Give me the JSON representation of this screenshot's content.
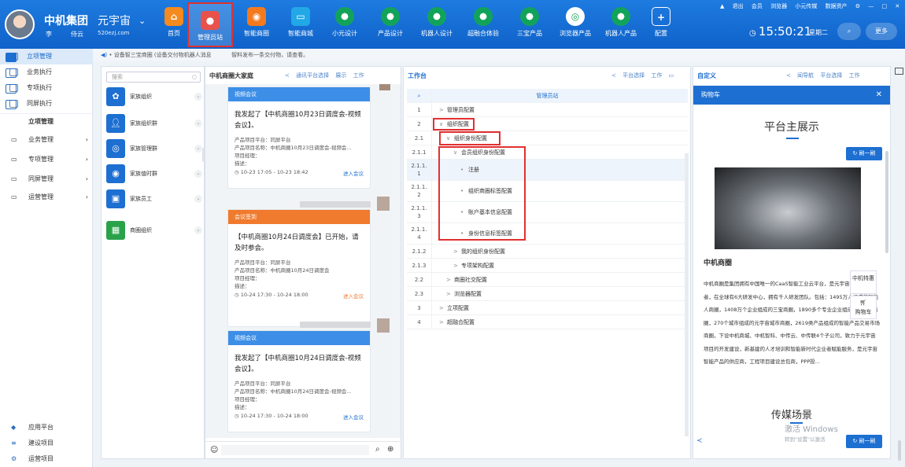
{
  "header": {
    "brand": "中机集团",
    "user_name": "李　　　侍云",
    "subtitle": "元宇宙",
    "subtitle_url": "520ezj.com",
    "nav": [
      {
        "label": "首页",
        "color": "#f58a1f",
        "icon": "home-icon"
      },
      {
        "label": "管理员站",
        "color": "#e8524a",
        "icon": "admin-icon"
      },
      {
        "label": "智能商圈",
        "color": "#f47a1e",
        "icon": "district-icon"
      },
      {
        "label": "智能商城",
        "color": "#22a8e6",
        "icon": "cart-icon"
      },
      {
        "label": "小元设计",
        "color": "#12a35a",
        "icon": "design-icon"
      },
      {
        "label": "产品设计",
        "color": "#12a35a",
        "icon": "product-icon"
      },
      {
        "label": "机器人设计",
        "color": "#12a35a",
        "icon": "robot-icon"
      },
      {
        "label": "超融合体验",
        "color": "#12a35a",
        "icon": "hci-icon"
      },
      {
        "label": "三宝产品",
        "color": "#12a35a",
        "icon": "sanbao-icon"
      },
      {
        "label": "浏览器产品",
        "color": "#ffffff",
        "icon": "browser-icon"
      },
      {
        "label": "机器人产品",
        "color": "#12a35a",
        "icon": "robot-product-icon"
      },
      {
        "label": "配置",
        "color": "transparent",
        "icon": "plus-icon"
      }
    ],
    "toplinks": [
      "退出",
      "会员",
      "浏览器",
      "小元传媒",
      "数据资产"
    ],
    "time": "15:50:21",
    "weekday": "星期二",
    "more": "更多"
  },
  "notice": "• 设备智三宝商圈 (设备交付物机器人消息 　　　 智料发布一条交付物，请查看。",
  "sidebar": {
    "top_items": [
      {
        "label": "立项管理",
        "selected": true
      },
      {
        "label": "业务执行"
      },
      {
        "label": "专项执行"
      },
      {
        "label": "同屏执行"
      }
    ],
    "section": "立项管理",
    "groups": [
      "业务管理",
      "专项管理",
      "同屏管理",
      "运营管理"
    ],
    "bottom_items": [
      "应用平台",
      "建设项目",
      "运营项目"
    ]
  },
  "org_panel": {
    "search_placeholder": "搜索",
    "items": [
      "家族组织",
      "家族组织群",
      "家族管理群",
      "家族值时群",
      "家族员工",
      "商圈组织"
    ]
  },
  "chat_panel": {
    "title": "中机商圈大家庭",
    "actions": [
      "通讯平台选择",
      "展示",
      "工作"
    ],
    "cards": [
      {
        "header": "视频会议",
        "color": "#3d8ee6",
        "title": "我发起了【中机商圈10月23日调度会-视频会议】。",
        "lines": [
          "产品项目平台：同屏平台",
          "产品项目名称：中机商圈10月23日调度会-视频会...",
          "项目经理：",
          "描述："
        ],
        "time": "10-23 17:05 - 10-23 18:42",
        "join": "进入会议"
      },
      {
        "header": "会议签到",
        "color": "#f07a2d",
        "title": "【中机商圈10月24日调度会】已开始，请及时参会。",
        "lines": [
          "产品项目平台：同屏平台",
          "产品项目名称：中机商圈10月24日调度会",
          "项目经理：",
          "描述："
        ],
        "time": "10-24 17:30 - 10-24 18:00",
        "join": "进入会议"
      },
      {
        "header": "视频会议",
        "color": "#3d8ee6",
        "title": "我发起了【中机商圈10月24日调度会-视频会议】。",
        "lines": [
          "产品项目平台：同屏平台",
          "产品项目名称：中机商圈10月24日调度会-视频会...",
          "项目经理：",
          "描述："
        ],
        "time": "10-24 17:30 - 10-24 18:00",
        "join": "进入会议"
      }
    ]
  },
  "work_panel": {
    "title": "工作台",
    "actions": [
      "平台选择",
      "工作"
    ],
    "column_header": "管理员站",
    "rows": [
      {
        "no": "1",
        "name": "管理员配置",
        "indent": 0,
        "exp": ">"
      },
      {
        "no": "2",
        "name": "组织配置",
        "indent": 0,
        "exp": "∨"
      },
      {
        "no": "2.1",
        "name": "组织身份配置",
        "indent": 1,
        "exp": "∨"
      },
      {
        "no": "2.1.1",
        "name": "会员组织身份配置",
        "indent": 2,
        "exp": "∨"
      },
      {
        "no": "2.1.1.\n1",
        "name": "注册",
        "indent": 3,
        "exp": "•",
        "hl": true
      },
      {
        "no": "2.1.1.\n2",
        "name": "组织商圈标签配置",
        "indent": 3,
        "exp": "•"
      },
      {
        "no": "2.1.1.\n3",
        "name": "账户基本信息配置",
        "indent": 3,
        "exp": "•"
      },
      {
        "no": "2.1.1.\n4",
        "name": "身份信息标签配置",
        "indent": 3,
        "exp": "•"
      },
      {
        "no": "2.1.2",
        "name": "我的组织身份配置",
        "indent": 2,
        "exp": ">"
      },
      {
        "no": "2.1.3",
        "name": "专项架构配置",
        "indent": 2,
        "exp": ">"
      },
      {
        "no": "2.2",
        "name": "商圈社交配置",
        "indent": 1,
        "exp": ">"
      },
      {
        "no": "2.3",
        "name": "浏览器配置",
        "indent": 1,
        "exp": ">"
      },
      {
        "no": "3",
        "name": "立项配置",
        "indent": 0,
        "exp": ">"
      },
      {
        "no": "4",
        "name": "超融合配置",
        "indent": 0,
        "exp": ">"
      }
    ]
  },
  "custom_panel": {
    "title": "自定义",
    "actions": [
      "闻导航",
      "平台选择",
      "工作"
    ],
    "cart_title": "购物车",
    "section_title": "平台主展示",
    "refresh": "刷一刷",
    "company": "中机商圈",
    "paragraph": "中机商圈是集团拥有中国唯一的CaaS智能工业云平台，是元宇宙技术的发明者，在全球有6大研发中心，拥有千人研发团队。包括：1495万人组成的智能人商圈，1408万个企业组成的三宝商圈，1890多个专业企业组成的智三宝商圈，270个城市组成的元宇宙城市商圈，2619类产品组成的智能产品交易市场商圈，下设中机商城、中机智科、中传云、中传联4个子公司，致力于元宇宙项目的开发建设，新基建的人才培训和智能新时代企业者赋能服务，是元宇宙智能产品的供应商，工程项目建设总包商，PPP投...",
    "next_title": "传媒场景",
    "float_tabs": [
      "中机特惠",
      "购物车"
    ],
    "watermark": "激活 Windows",
    "watermark_sub": "转到\"设置\"以激活"
  }
}
